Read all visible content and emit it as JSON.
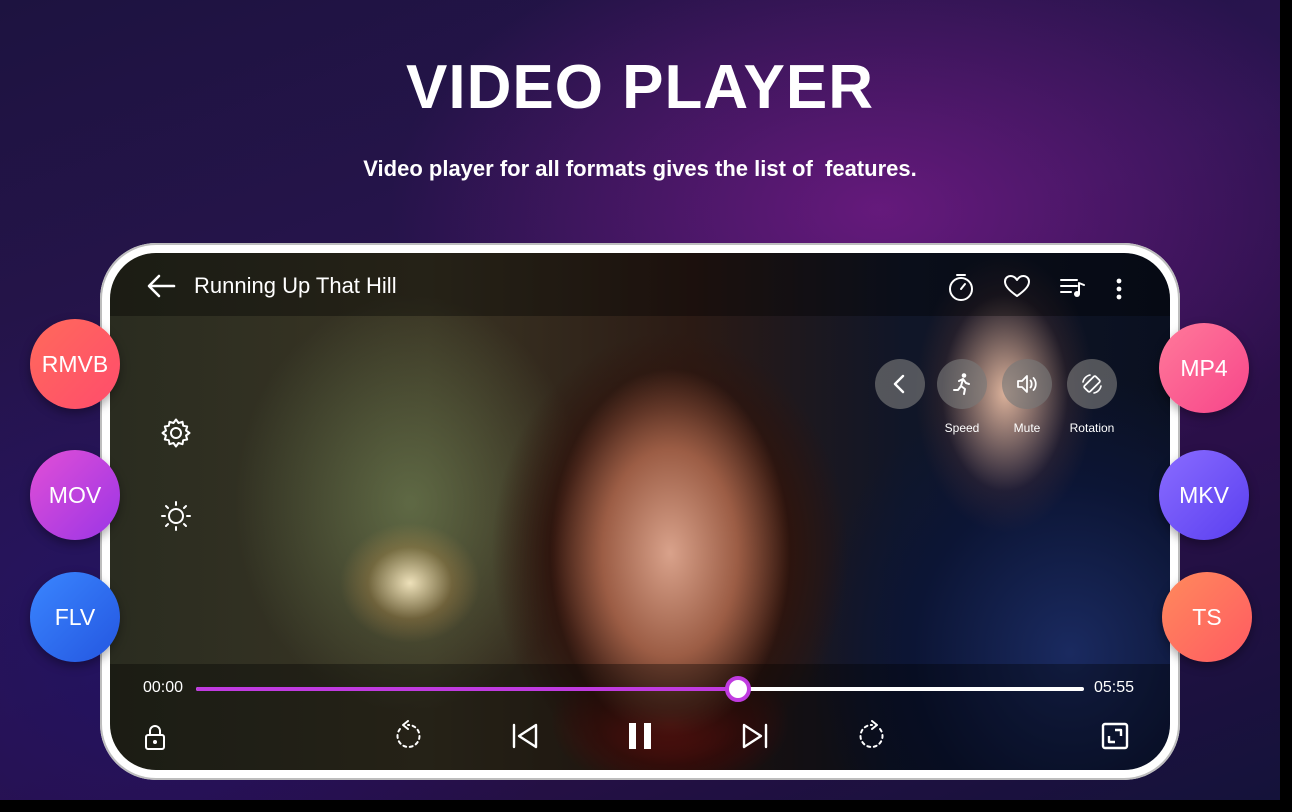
{
  "header": {
    "title": "VIDEO PLAYER",
    "subtitle": "Video player for all formats gives the list of  features."
  },
  "player": {
    "video_title": "Running Up That Hill",
    "top_icons": [
      "back-arrow-icon",
      "timer-icon",
      "heart-icon",
      "playlist-icon",
      "more-vert-icon"
    ],
    "quick_actions": [
      {
        "label": "Speed",
        "icon": "running-person-icon"
      },
      {
        "label": "Mute",
        "icon": "speaker-icon"
      },
      {
        "label": "Rotation",
        "icon": "rotate-icon"
      }
    ],
    "side_icons": [
      "settings-gear-icon",
      "brightness-icon"
    ],
    "current_time": "00:00",
    "total_time": "05:55",
    "progress": 0.61,
    "bottom_controls": [
      "lock-icon",
      "rewind-icon",
      "previous-icon",
      "pause-icon",
      "next-icon",
      "forward-icon",
      "fullscreen-icon"
    ]
  },
  "formats": {
    "left": [
      {
        "label": "RMVB",
        "color_from": "#ff6a5b",
        "color_to": "#ff4c6c"
      },
      {
        "label": "MOV",
        "color_from": "#e24fd6",
        "color_to": "#9a35e6"
      },
      {
        "label": "FLV",
        "color_from": "#3a86ff",
        "color_to": "#2456e0"
      }
    ],
    "right": [
      {
        "label": "MP4",
        "color_from": "#ff7a9a",
        "color_to": "#f7458a"
      },
      {
        "label": "MKV",
        "color_from": "#8a6cff",
        "color_to": "#5a3ff0"
      },
      {
        "label": "TS",
        "color_from": "#ff8a5c",
        "color_to": "#ff5a62"
      }
    ]
  },
  "colors": {
    "accent": "#c03be0",
    "background": "#241447"
  }
}
